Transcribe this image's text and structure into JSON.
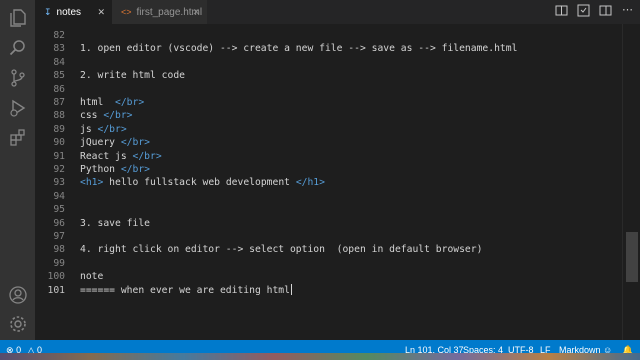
{
  "tabs": [
    {
      "label": "notes",
      "icon": "pin-icon",
      "active": true
    },
    {
      "label": "first_page.html",
      "icon": "html-file-icon",
      "active": false
    }
  ],
  "activity_bar": [
    "files-icon",
    "search-icon",
    "source-control-icon",
    "run-debug-icon",
    "extensions-icon",
    "account-icon",
    "settings-gear-icon"
  ],
  "editor": {
    "lines": [
      {
        "n": "82",
        "segments": []
      },
      {
        "n": "83",
        "segments": [
          {
            "t": "1. open editor (vscode) --> create a new file --> save as --> filename.html"
          }
        ]
      },
      {
        "n": "84",
        "segments": []
      },
      {
        "n": "85",
        "segments": [
          {
            "t": "2. write html code"
          }
        ]
      },
      {
        "n": "86",
        "segments": []
      },
      {
        "n": "87",
        "segments": [
          {
            "t": "html  "
          },
          {
            "t": "</br>",
            "cls": "tag"
          }
        ]
      },
      {
        "n": "88",
        "segments": [
          {
            "t": "css "
          },
          {
            "t": "</br>",
            "cls": "tag"
          }
        ]
      },
      {
        "n": "89",
        "segments": [
          {
            "t": "js "
          },
          {
            "t": "</br>",
            "cls": "tag"
          }
        ]
      },
      {
        "n": "90",
        "segments": [
          {
            "t": "jQuery "
          },
          {
            "t": "</br>",
            "cls": "tag"
          }
        ]
      },
      {
        "n": "91",
        "segments": [
          {
            "t": "React js "
          },
          {
            "t": "</br>",
            "cls": "tag"
          }
        ]
      },
      {
        "n": "92",
        "segments": [
          {
            "t": "Python "
          },
          {
            "t": "</br>",
            "cls": "tag"
          }
        ]
      },
      {
        "n": "93",
        "segments": [
          {
            "t": "<h1>",
            "cls": "tag"
          },
          {
            "t": " hello fullstack web development "
          },
          {
            "t": "</h1>",
            "cls": "tag"
          }
        ]
      },
      {
        "n": "94",
        "segments": []
      },
      {
        "n": "95",
        "segments": []
      },
      {
        "n": "96",
        "segments": [
          {
            "t": "3. save file"
          }
        ]
      },
      {
        "n": "97",
        "segments": []
      },
      {
        "n": "98",
        "segments": [
          {
            "t": "4. right click on editor --> select option  (open in default browser)"
          }
        ]
      },
      {
        "n": "99",
        "segments": []
      },
      {
        "n": "100",
        "segments": [
          {
            "t": "note"
          }
        ]
      },
      {
        "n": "101",
        "segments": [
          {
            "t": "====== when ever we are editing html"
          }
        ],
        "current": true
      }
    ]
  },
  "status_bar": {
    "errors": "0",
    "warnings": "0",
    "position": "Ln 101, Col 37",
    "spaces": "Spaces: 4",
    "encoding": "UTF-8",
    "eol": "LF",
    "language": "Markdown"
  },
  "colors": {
    "status_bar": "#007acc",
    "tag": "#569cd6",
    "editor_bg": "#1e1e1e"
  }
}
